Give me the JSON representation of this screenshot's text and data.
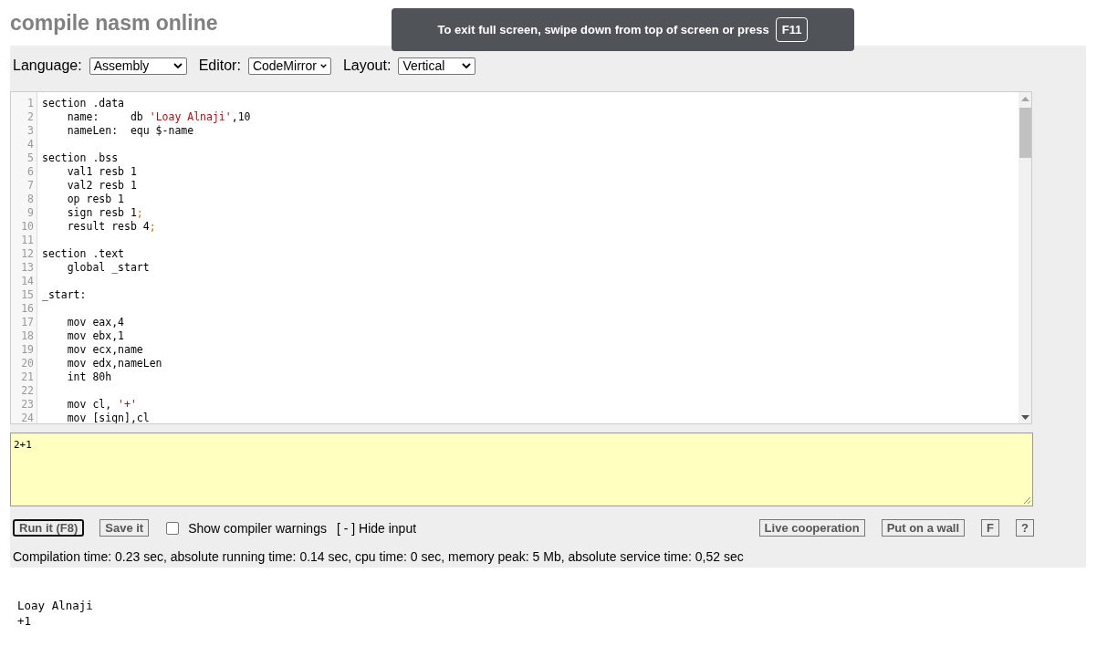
{
  "page_title": "compile nasm online",
  "fullscreen_notice": {
    "text": "To exit full screen, swipe down from top of screen or press",
    "key": "F11"
  },
  "toolbar": [
    {
      "label": "Language:",
      "value": "Assembly"
    },
    {
      "label": "Editor:",
      "value": "CodeMirror"
    },
    {
      "label": "Layout:",
      "value": "Vertical"
    }
  ],
  "editor": {
    "lines": [
      {
        "number": "1",
        "segments": [
          {
            "kind": "plain",
            "text": "section .data"
          }
        ]
      },
      {
        "number": "2",
        "segments": [
          {
            "kind": "plain",
            "text": "    name:     db "
          },
          {
            "kind": "string",
            "text": "'Loay Alnaji'"
          },
          {
            "kind": "plain",
            "text": ",10"
          }
        ]
      },
      {
        "number": "3",
        "segments": [
          {
            "kind": "plain",
            "text": "    nameLen:  equ $-name"
          }
        ]
      },
      {
        "number": "4"
      },
      {
        "number": "5",
        "segments": [
          {
            "kind": "plain",
            "text": "section .bss"
          }
        ]
      },
      {
        "number": "6",
        "segments": [
          {
            "kind": "plain",
            "text": "    val1 resb 1"
          }
        ]
      },
      {
        "number": "7",
        "segments": [
          {
            "kind": "plain",
            "text": "    val2 resb 1"
          }
        ]
      },
      {
        "number": "8",
        "segments": [
          {
            "kind": "plain",
            "text": "    op resb 1"
          }
        ]
      },
      {
        "number": "9",
        "segments": [
          {
            "kind": "plain",
            "text": "    sign resb 1"
          },
          {
            "kind": "comment",
            "text": ";"
          }
        ]
      },
      {
        "number": "10",
        "segments": [
          {
            "kind": "plain",
            "text": "    result resb 4"
          },
          {
            "kind": "comment",
            "text": ";"
          }
        ]
      },
      {
        "number": "11"
      },
      {
        "number": "12",
        "segments": [
          {
            "kind": "plain",
            "text": "section .text"
          }
        ]
      },
      {
        "number": "13",
        "segments": [
          {
            "kind": "plain",
            "text": "    global _start"
          }
        ]
      },
      {
        "number": "14"
      },
      {
        "number": "15",
        "segments": [
          {
            "kind": "plain",
            "text": "_start:"
          }
        ]
      },
      {
        "number": "16"
      },
      {
        "number": "17",
        "segments": [
          {
            "kind": "plain",
            "text": "    mov eax,4"
          }
        ]
      },
      {
        "number": "18",
        "segments": [
          {
            "kind": "plain",
            "text": "    mov ebx,1"
          }
        ]
      },
      {
        "number": "19",
        "segments": [
          {
            "kind": "plain",
            "text": "    mov ecx,name"
          }
        ]
      },
      {
        "number": "20",
        "segments": [
          {
            "kind": "plain",
            "text": "    mov edx,nameLen"
          }
        ]
      },
      {
        "number": "21",
        "segments": [
          {
            "kind": "plain",
            "text": "    int 80h"
          }
        ]
      },
      {
        "number": "22"
      },
      {
        "number": "23",
        "segments": [
          {
            "kind": "plain",
            "text": "    mov cl, "
          },
          {
            "kind": "string",
            "text": "'+'"
          }
        ]
      },
      {
        "number": "24",
        "segments": [
          {
            "kind": "plain",
            "text": "    mov [sign],cl"
          }
        ]
      }
    ]
  },
  "input": {
    "value": "2+1"
  },
  "actions": [
    {
      "label": "Run it (F8)",
      "focused": true
    },
    {
      "label": "Save it",
      "focused": false
    }
  ],
  "warnings": {
    "label": "Show compiler warnings",
    "checked": false
  },
  "hide_input": "[ - ] Hide input",
  "right_actions": [
    {
      "label": "Live cooperation"
    },
    {
      "label": "Put on a wall"
    },
    {
      "label": "F"
    },
    {
      "label": "?"
    }
  ],
  "stats": "Compilation time: 0.23 sec, absolute running time: 0.14 sec, cpu time: 0 sec, memory peak: 5 Mb, absolute service time: 0,52 sec",
  "output": [
    "Loay Alnaji",
    "+1"
  ]
}
